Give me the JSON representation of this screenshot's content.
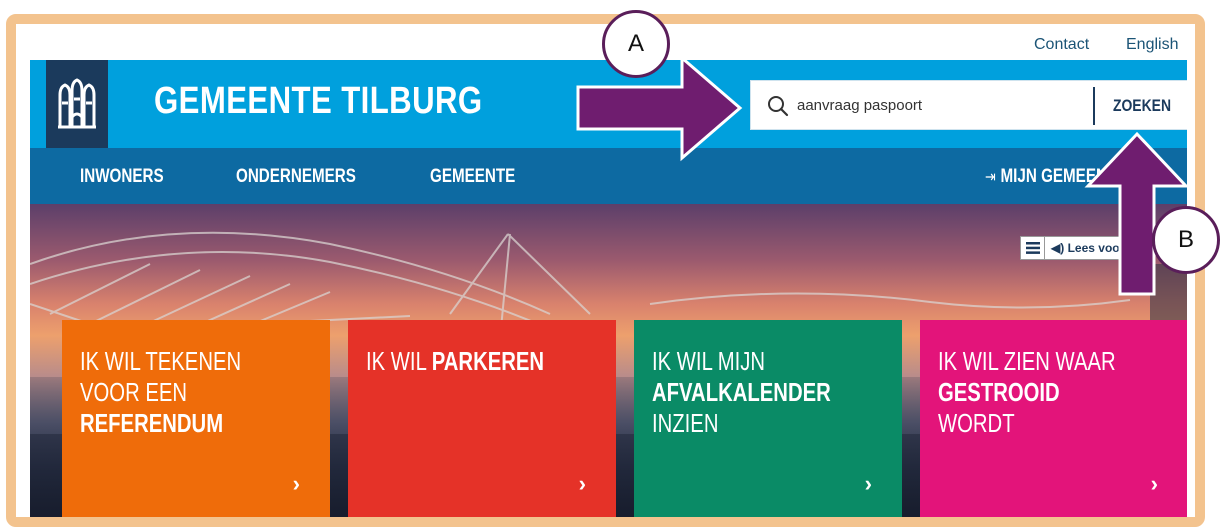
{
  "utility": {
    "contact": "Contact",
    "language": "English"
  },
  "header": {
    "title": "GEMEENTE TILBURG",
    "logo": "tilburg-castle-logo-icon"
  },
  "search": {
    "value": "aanvraag paspoort",
    "button": "ZOEKEN"
  },
  "nav": {
    "items": [
      {
        "label": "INWONERS"
      },
      {
        "label": "ONDERNEMERS"
      },
      {
        "label": "GEMEENTE"
      }
    ],
    "account": "MIJN GEMEENTE"
  },
  "readspeaker": {
    "label": "Lees voor"
  },
  "tiles": [
    {
      "line1": "IK WIL TEKENEN",
      "line2": "VOOR EEN",
      "line3": "REFERENDUM",
      "color": "#ef6c0a"
    },
    {
      "line1": "IK WIL",
      "line1_bold": "PARKEREN",
      "color": "#e53228"
    },
    {
      "line1": "IK WIL MIJN",
      "line2": "AFVALKALENDER",
      "line3": "INZIEN",
      "color": "#0a8b66"
    },
    {
      "line1": "IK WIL ZIEN WAAR",
      "line2": "GESTROOID",
      "line3": "WORDT",
      "color": "#e3147a"
    }
  ],
  "chevron": "›",
  "annotations": {
    "a": "A",
    "b": "B"
  },
  "colors": {
    "frame": "#f3c38e",
    "header": "#00a0dd",
    "nav": "#0d6aa2",
    "logo_bg": "#1b3a5c",
    "arrow": "#6f1d6f"
  }
}
